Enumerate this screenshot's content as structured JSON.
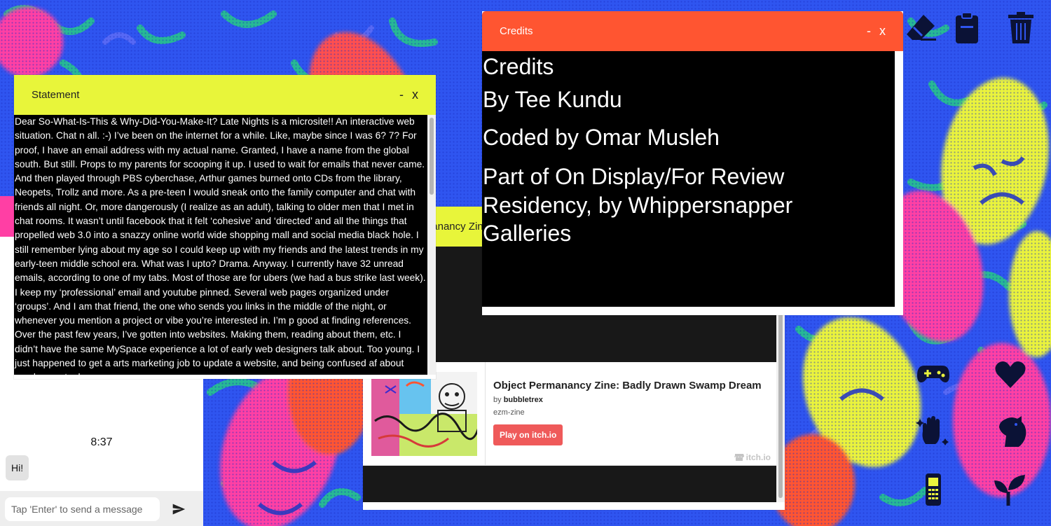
{
  "statement": {
    "title": "Statement",
    "minimize": "-",
    "close": "x",
    "text": "Dear So-What-Is-This & Why-Did-You-Make-It? Late Nights is a microsite!! An interactive web situation. Chat n all. :-) I’ve been on the internet for a while. Like, maybe since I was 6? 7? For proof, I have an email address with my actual name. Granted, I have a name from the global south. But still. Props to my parents for scooping it up. I used to wait for emails that never came. And then played through PBS cyberchase, Arthur games burned onto CDs from the library, Neopets, Trollz and more. As a pre-teen I would sneak onto the family computer and chat with friends all night. Or, more dangerously (I realize as an adult), talking to older men that I met in chat rooms. It wasn’t until facebook that it felt ‘cohesive’ and ‘directed’ and all the things that propelled web 3.0 into a snazzy online world wide shopping mall and social media black hole. I still remember lying about my age so I could keep up with my friends and the latest trends in my early-teen middle school era. What was I upto? Drama. Anyway. I currently have 32 unread emails, according to one of my tabs. Most of those are for ubers (we had a bus strike last week). I keep my ‘professional’ email and youtube pinned. Several web pages organized under ‘groups’. And I am that friend, the one who sends you links in the middle of the night, or whenever you mention a project or vibe you’re interested in. I’m p good at finding references. Over the past few years, I’ve gotten into websites. Making them, reading about them, etc. I didn’t have the same MySpace experience a lot of early web designers talk about. Too young. I just happened to get a arts marketing job to update a website, and being confused af about wordpress, took a"
  },
  "credits": {
    "title": "Credits",
    "minimize": "-",
    "close": "x",
    "heading": "Credits",
    "by": "By Tee Kundu",
    "coded": "Coded by Omar Musleh",
    "part": "Part of On Display/For Review Residency, by Whippersnapper Galleries"
  },
  "game": {
    "title": "Object Permanancy Zine",
    "card_title": "Object Permanancy Zine: Badly Drawn Swamp Dream",
    "by_prefix": "by",
    "author": "bubbletrex",
    "tag": "ezm-zine",
    "play_label": "Play on itch.io",
    "logo": "itch.io"
  },
  "chat": {
    "time": "8:37",
    "message": "Hi!",
    "placeholder": "Tap 'Enter' to send a message"
  },
  "desktop_icons": [
    "eraser-icon",
    "clipboard-icon",
    "trash-icon",
    "gamepad-icon",
    "heart-icon",
    "sparkle-hand-icon",
    "horse-icon",
    "phone-icon",
    "sprout-icon"
  ],
  "colors": {
    "background": "#2f55f0",
    "statement_bar": "#e8f53a",
    "credits_bar": "#ff5531",
    "play_button": "#ef5a5a",
    "icon": "#0b1236"
  }
}
